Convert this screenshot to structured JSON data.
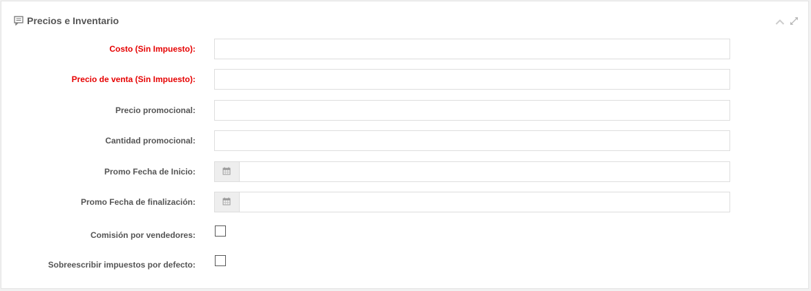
{
  "panel": {
    "title": "Precios e Inventario",
    "header_icon": "comment-icon",
    "collapse_icon": "chevron-up-icon",
    "expand_icon": "expand-icon"
  },
  "fields": {
    "cost": {
      "label": "Costo (Sin Impuesto):",
      "value": "",
      "required": true
    },
    "sale_price": {
      "label": "Precio de venta (Sin Impuesto):",
      "value": "",
      "required": true
    },
    "promo_price": {
      "label": "Precio promocional:",
      "value": ""
    },
    "promo_quantity": {
      "label": "Cantidad promocional:",
      "value": ""
    },
    "promo_start": {
      "label": "Promo Fecha de Inicio:",
      "value": "",
      "icon": "calendar-icon"
    },
    "promo_end": {
      "label": "Promo Fecha de finalización:",
      "value": "",
      "icon": "calendar-icon"
    },
    "commission": {
      "label": "Comisión por vendedores:",
      "checked": false
    },
    "override_taxes": {
      "label": "Sobreescribir impuestos por defecto:",
      "checked": false
    }
  },
  "colors": {
    "required_label": "#e60000",
    "label": "#555555",
    "border": "#dddddd",
    "addon_bg": "#eeeeee"
  }
}
